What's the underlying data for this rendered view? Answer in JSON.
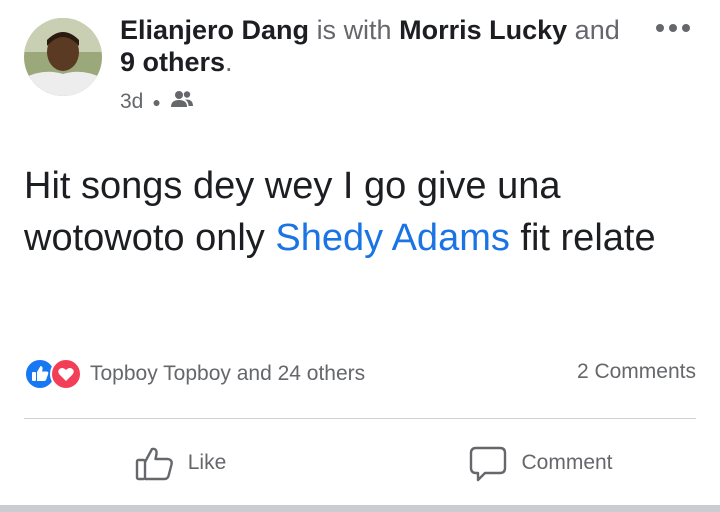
{
  "post": {
    "author": "Elianjero Dang",
    "with_text": "is with",
    "tagged": "Morris Lucky",
    "and_text": "and",
    "others": "9 others",
    "period": ".",
    "time": "3d",
    "audience_icon": "friends-icon",
    "more_icon": "more-options-icon",
    "text_before": "Hit songs dey wey I go give una wotowoto only ",
    "mention": "Shedy Adams",
    "text_after": " fit relate"
  },
  "reactions": {
    "icons": [
      "like-icon",
      "love-icon"
    ],
    "summary": "Topboy Topboy and 24 others"
  },
  "comments": {
    "count_label": "2 Comments"
  },
  "actions": {
    "like_label": "Like",
    "comment_label": "Comment"
  },
  "colors": {
    "link": "#1b74e4",
    "like": "#1877f2",
    "love": "#f33e58",
    "secondary_text": "#65676b"
  }
}
